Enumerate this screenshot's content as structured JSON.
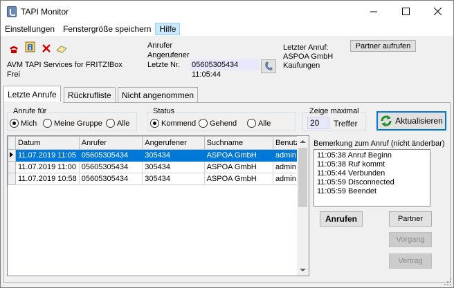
{
  "window": {
    "title": "TAPI Monitor"
  },
  "menu": [
    "Einstellungen",
    "Fenstergröße speichern",
    "Hilfe"
  ],
  "header": {
    "service_name": "AVM TAPI Services for FRITZ!Box",
    "service_state": "Frei",
    "anrufer_label": "Anrufer",
    "angerufener_label": "Angerufener",
    "letzte_nr_label": "Letzte Nr.",
    "letzte_nr_value": "05605305434",
    "time": "11:05:44",
    "letzter_anruf_label": "Letzter Anruf:",
    "letzter_anruf_company": "ASPOA GmbH",
    "letzter_anruf_city": "Kaufungen",
    "partner_aufrufen": "Partner aufrufen"
  },
  "tabs": [
    "Letzte Anrufe",
    "Rückrufliste",
    "Nicht angenommen"
  ],
  "filters": {
    "anrufe_fuer_title": "Anrufe für",
    "anrufe_fuer_options": [
      "Mich",
      "Meine Gruppe",
      "Alle"
    ],
    "status_title": "Status",
    "status_options": [
      "Kommend",
      "Gehend",
      "Alle"
    ],
    "zeige_title": "Zeige maximal",
    "zeige_value": "20",
    "zeige_unit": "Treffer",
    "refresh_label": "Aktualisieren"
  },
  "grid": {
    "columns": [
      "Datum",
      "Anrufer",
      "Angerufener",
      "Suchname",
      "Benutzer"
    ],
    "rows": [
      [
        "11.07.2019 11:05",
        "05605305434",
        "305434",
        "ASPOA GmbH",
        "admin"
      ],
      [
        "11.07.2019 11:00",
        "05605305434",
        "305434",
        "ASPOA GmbH",
        "admin"
      ],
      [
        "11.07.2019 10:58",
        "05605305434",
        "305434",
        "ASPOA GmbH",
        "admin"
      ]
    ]
  },
  "note": {
    "title": "Bemerkung zum Anruf (nicht änderbar)",
    "lines": [
      "11:05:38 Anruf Beginn",
      "11:05:38 Ruf kommt",
      "11:05:44 Verbunden",
      "11:05:59 Disconnected",
      "11:05:59 Beendet"
    ]
  },
  "buttons": {
    "anrufen": "Anrufen",
    "partner": "Partner",
    "vorgang": "Vorgang",
    "vertrag": "Vertrag"
  },
  "colors": {
    "selection": "#0078d7",
    "accent_green": "#1e8f2e",
    "phone_blue": "#6b88b4"
  }
}
